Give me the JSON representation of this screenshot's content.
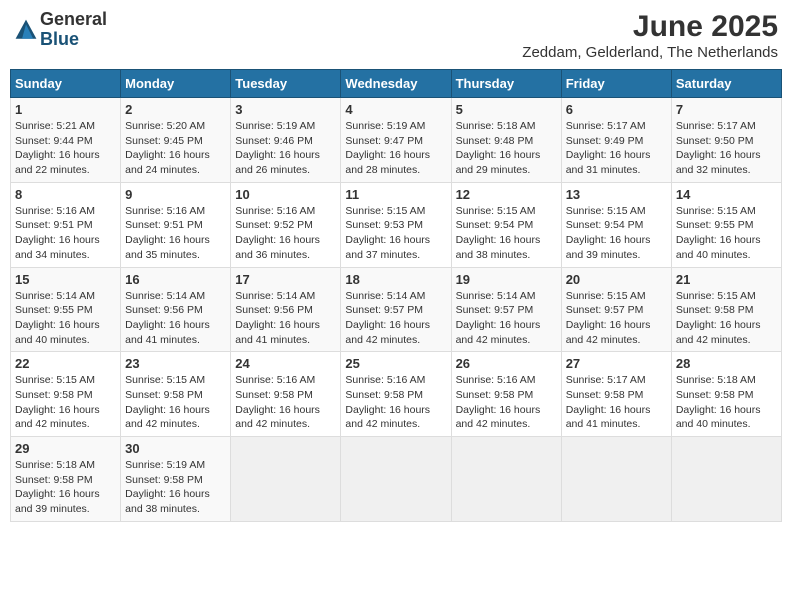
{
  "logo": {
    "general": "General",
    "blue": "Blue"
  },
  "title": {
    "month_year": "June 2025",
    "location": "Zeddam, Gelderland, The Netherlands"
  },
  "weekdays": [
    "Sunday",
    "Monday",
    "Tuesday",
    "Wednesday",
    "Thursday",
    "Friday",
    "Saturday"
  ],
  "weeks": [
    [
      {
        "day": 1,
        "sunrise": "5:21 AM",
        "sunset": "9:44 PM",
        "daylight": "16 hours and 22 minutes."
      },
      {
        "day": 2,
        "sunrise": "5:20 AM",
        "sunset": "9:45 PM",
        "daylight": "16 hours and 24 minutes."
      },
      {
        "day": 3,
        "sunrise": "5:19 AM",
        "sunset": "9:46 PM",
        "daylight": "16 hours and 26 minutes."
      },
      {
        "day": 4,
        "sunrise": "5:19 AM",
        "sunset": "9:47 PM",
        "daylight": "16 hours and 28 minutes."
      },
      {
        "day": 5,
        "sunrise": "5:18 AM",
        "sunset": "9:48 PM",
        "daylight": "16 hours and 29 minutes."
      },
      {
        "day": 6,
        "sunrise": "5:17 AM",
        "sunset": "9:49 PM",
        "daylight": "16 hours and 31 minutes."
      },
      {
        "day": 7,
        "sunrise": "5:17 AM",
        "sunset": "9:50 PM",
        "daylight": "16 hours and 32 minutes."
      }
    ],
    [
      {
        "day": 8,
        "sunrise": "5:16 AM",
        "sunset": "9:51 PM",
        "daylight": "16 hours and 34 minutes."
      },
      {
        "day": 9,
        "sunrise": "5:16 AM",
        "sunset": "9:51 PM",
        "daylight": "16 hours and 35 minutes."
      },
      {
        "day": 10,
        "sunrise": "5:16 AM",
        "sunset": "9:52 PM",
        "daylight": "16 hours and 36 minutes."
      },
      {
        "day": 11,
        "sunrise": "5:15 AM",
        "sunset": "9:53 PM",
        "daylight": "16 hours and 37 minutes."
      },
      {
        "day": 12,
        "sunrise": "5:15 AM",
        "sunset": "9:54 PM",
        "daylight": "16 hours and 38 minutes."
      },
      {
        "day": 13,
        "sunrise": "5:15 AM",
        "sunset": "9:54 PM",
        "daylight": "16 hours and 39 minutes."
      },
      {
        "day": 14,
        "sunrise": "5:15 AM",
        "sunset": "9:55 PM",
        "daylight": "16 hours and 40 minutes."
      }
    ],
    [
      {
        "day": 15,
        "sunrise": "5:14 AM",
        "sunset": "9:55 PM",
        "daylight": "16 hours and 40 minutes."
      },
      {
        "day": 16,
        "sunrise": "5:14 AM",
        "sunset": "9:56 PM",
        "daylight": "16 hours and 41 minutes."
      },
      {
        "day": 17,
        "sunrise": "5:14 AM",
        "sunset": "9:56 PM",
        "daylight": "16 hours and 41 minutes."
      },
      {
        "day": 18,
        "sunrise": "5:14 AM",
        "sunset": "9:57 PM",
        "daylight": "16 hours and 42 minutes."
      },
      {
        "day": 19,
        "sunrise": "5:14 AM",
        "sunset": "9:57 PM",
        "daylight": "16 hours and 42 minutes."
      },
      {
        "day": 20,
        "sunrise": "5:15 AM",
        "sunset": "9:57 PM",
        "daylight": "16 hours and 42 minutes."
      },
      {
        "day": 21,
        "sunrise": "5:15 AM",
        "sunset": "9:58 PM",
        "daylight": "16 hours and 42 minutes."
      }
    ],
    [
      {
        "day": 22,
        "sunrise": "5:15 AM",
        "sunset": "9:58 PM",
        "daylight": "16 hours and 42 minutes."
      },
      {
        "day": 23,
        "sunrise": "5:15 AM",
        "sunset": "9:58 PM",
        "daylight": "16 hours and 42 minutes."
      },
      {
        "day": 24,
        "sunrise": "5:16 AM",
        "sunset": "9:58 PM",
        "daylight": "16 hours and 42 minutes."
      },
      {
        "day": 25,
        "sunrise": "5:16 AM",
        "sunset": "9:58 PM",
        "daylight": "16 hours and 42 minutes."
      },
      {
        "day": 26,
        "sunrise": "5:16 AM",
        "sunset": "9:58 PM",
        "daylight": "16 hours and 42 minutes."
      },
      {
        "day": 27,
        "sunrise": "5:17 AM",
        "sunset": "9:58 PM",
        "daylight": "16 hours and 41 minutes."
      },
      {
        "day": 28,
        "sunrise": "5:18 AM",
        "sunset": "9:58 PM",
        "daylight": "16 hours and 40 minutes."
      }
    ],
    [
      {
        "day": 29,
        "sunrise": "5:18 AM",
        "sunset": "9:58 PM",
        "daylight": "16 hours and 39 minutes."
      },
      {
        "day": 30,
        "sunrise": "5:19 AM",
        "sunset": "9:58 PM",
        "daylight": "16 hours and 38 minutes."
      },
      null,
      null,
      null,
      null,
      null
    ]
  ]
}
